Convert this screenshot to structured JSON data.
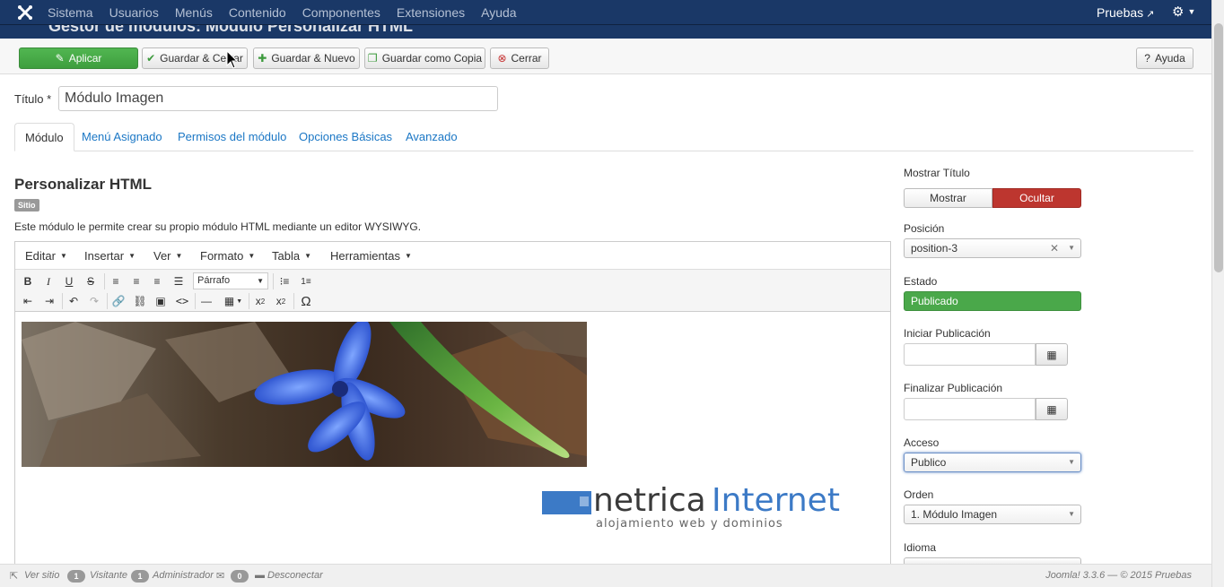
{
  "navbar": {
    "menu": [
      "Sistema",
      "Usuarios",
      "Menús",
      "Contenido",
      "Componentes",
      "Extensiones",
      "Ayuda"
    ],
    "site_link": "Pruebas"
  },
  "header": {
    "title": "Gestor de módulos: Módulo Personalizar HTML"
  },
  "toolbar": {
    "apply": "Aplicar",
    "save_close": "Guardar & Cerrar",
    "save_new": "Guardar & Nuevo",
    "save_copy": "Guardar como Copia",
    "close": "Cerrar",
    "help": "Ayuda"
  },
  "title_field": {
    "label": "Título *",
    "value": "Módulo Imagen"
  },
  "tabs": [
    "Módulo",
    "Menú Asignado",
    "Permisos del módulo",
    "Opciones Básicas",
    "Avanzado"
  ],
  "module": {
    "name": "Personalizar HTML",
    "badge": "Sitio",
    "description": "Este módulo le permite crear su propio módulo HTML mediante un editor WYSIWYG."
  },
  "editor": {
    "menus": [
      "Editar",
      "Insertar",
      "Ver",
      "Formato",
      "Tabla",
      "Herramientas"
    ],
    "format_select": "Párrafo",
    "logo_text_a": "netrica",
    "logo_text_b": "Internet",
    "logo_tagline": "alojamiento web y dominios"
  },
  "sidebar": {
    "show_title_label": "Mostrar Título",
    "show": "Mostrar",
    "hide": "Ocultar",
    "position_label": "Posición",
    "position_value": "position-3",
    "state_label": "Estado",
    "state_value": "Publicado",
    "start_label": "Iniciar Publicación",
    "end_label": "Finalizar Publicación",
    "access_label": "Acceso",
    "access_value": "Publico",
    "order_label": "Orden",
    "order_value": "1. Módulo Imagen",
    "language_label": "Idioma"
  },
  "statusbar": {
    "view_site": "Ver sitio",
    "visitors_count": "1",
    "visitors_label": "Visitante",
    "admins_count": "1",
    "admins_label": "Administrador",
    "messages_count": "0",
    "logout": "Desconectar",
    "footer": "Joomla! 3.3.6 — © 2015 Pruebas"
  },
  "colors": {
    "navbar": "#1a3867",
    "apply": "#46a546",
    "hide_active": "#bd362f",
    "published": "#4aa84a",
    "link": "#1b77c5"
  }
}
